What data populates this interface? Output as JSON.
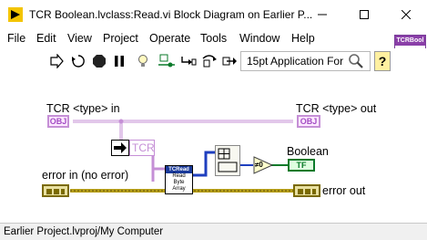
{
  "window": {
    "title": "TCR Boolean.lvclass:Read.vi Block Diagram on Earlier P...",
    "controls": {
      "minimize": "minimize",
      "maximize": "maximize",
      "close": "close"
    }
  },
  "menu": [
    "File",
    "Edit",
    "View",
    "Project",
    "Operate",
    "Tools",
    "Window",
    "Help"
  ],
  "toolbar": {
    "buttons": [
      "run-arrow-icon",
      "run-continuously-icon",
      "abort-icon",
      "pause-icon",
      "highlight-execution-icon",
      "retain-wire-values-icon",
      "step-into-icon",
      "step-over-icon",
      "step-out-icon"
    ],
    "font_select": "15pt Application For",
    "help_label": "?"
  },
  "class_icon": {
    "header": "TCRBool",
    "glyph": "∞"
  },
  "diagram": {
    "tcr_in_label": "TCR <type> in",
    "tcr_out_label": "TCR <type> out",
    "obj_in_text": "OBJ",
    "obj_out_text": "OBJ",
    "tcr_property_label": "TCR",
    "error_in_label": "error in (no error)",
    "error_out_label": "error out",
    "boolean_label": "Boolean",
    "boolean_terminal_text": "TF",
    "tcr_read_header": "TCRead",
    "tcr_read_lines": [
      "Read",
      "Byte",
      "Array"
    ],
    "compare_text": "≠0"
  },
  "status": {
    "path": "Earlier Project.lvproj/My Computer"
  },
  "colors": {
    "class_wire": "#c58fd6",
    "error_wire": "#7a6a00",
    "bool_wire": "#0b7a2a",
    "array_wire": "#1f3fbf"
  }
}
